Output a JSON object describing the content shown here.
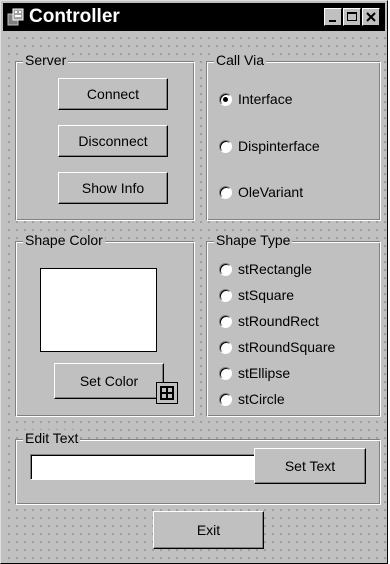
{
  "window": {
    "title": "Controller"
  },
  "server": {
    "group_label": "Server",
    "connect_label": "Connect",
    "disconnect_label": "Disconnect",
    "show_info_label": "Show Info"
  },
  "call_via": {
    "group_label": "Call Via",
    "options": [
      "Interface",
      "Dispinterface",
      "OleVariant"
    ],
    "selected": "Interface"
  },
  "shape_color": {
    "group_label": "Shape Color",
    "swatch_color": "#ffffff",
    "set_color_label": "Set Color"
  },
  "shape_type": {
    "group_label": "Shape Type",
    "options": [
      "stRectangle",
      "stSquare",
      "stRoundRect",
      "stRoundSquare",
      "stEllipse",
      "stCircle"
    ],
    "selected": null
  },
  "edit_text": {
    "group_label": "Edit Text",
    "value": "",
    "set_text_label": "Set Text"
  },
  "footer": {
    "exit_label": "Exit"
  },
  "icons": [
    "app-icon",
    "minimize-icon",
    "maximize-icon",
    "close-icon",
    "color-palette-icon"
  ]
}
